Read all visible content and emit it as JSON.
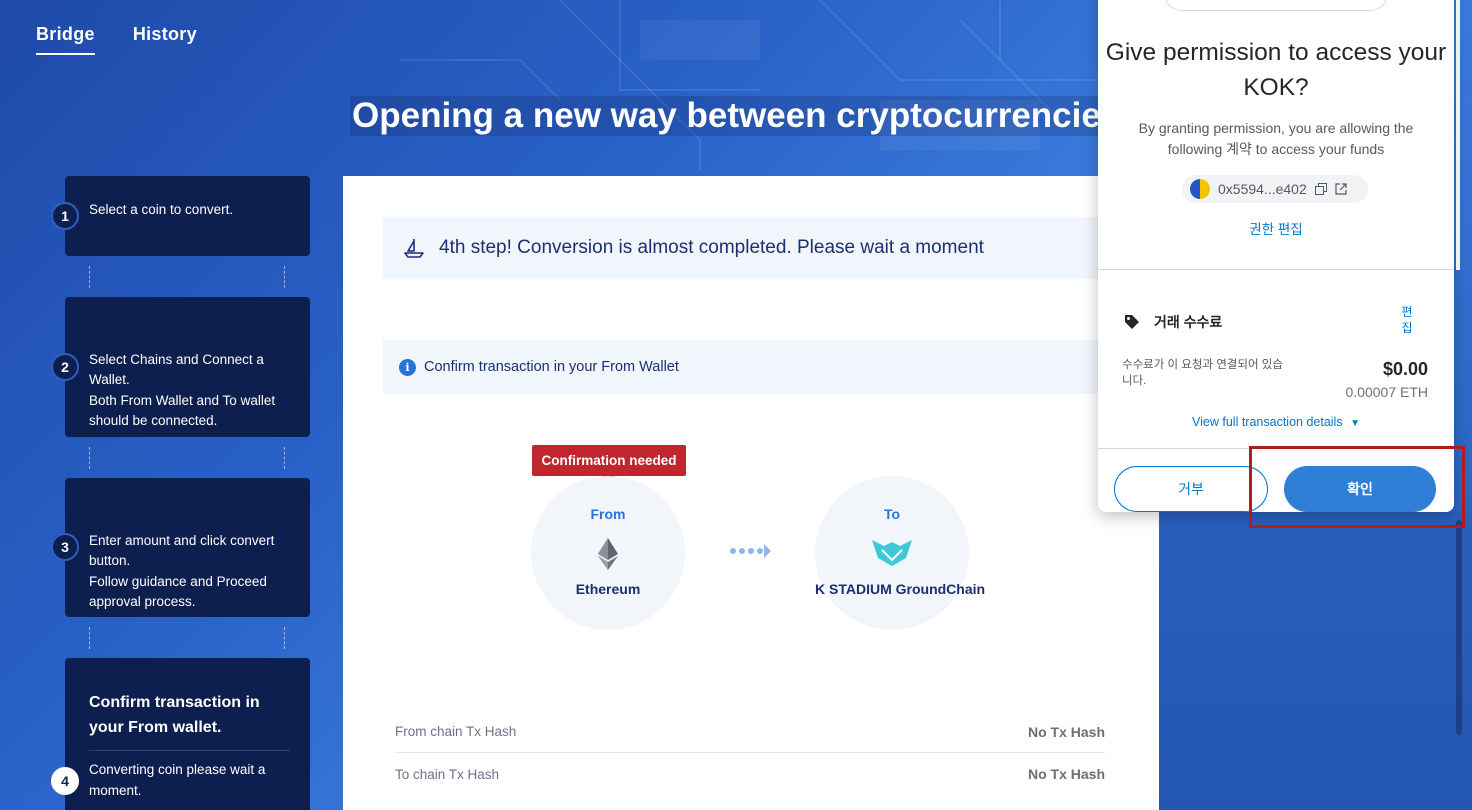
{
  "nav": {
    "tabs": [
      {
        "label": "Bridge",
        "active": true
      },
      {
        "label": "History",
        "active": false
      }
    ]
  },
  "hero": {
    "title": "Opening a new way between cryptocurrencies."
  },
  "steps": [
    {
      "number": "1",
      "text": "Select a coin to convert."
    },
    {
      "number": "2",
      "text": "Select Chains and Connect a Wallet.\nBoth From Wallet and To wallet should be connected."
    },
    {
      "number": "3",
      "text": "Enter amount and click convert button.\nFollow guidance and Proceed approval process."
    },
    {
      "number": "4",
      "title": "Confirm transaction in your From wallet.",
      "text": "Converting coin please wait a moment."
    }
  ],
  "main": {
    "notice": "4th step! Conversion is almost completed. Please wait a moment",
    "info": "Confirm transaction in your From Wallet",
    "info_icon": "i",
    "confirm_tag": "Confirmation needed",
    "from": {
      "label": "From",
      "chain": "Ethereum"
    },
    "to": {
      "label": "To",
      "chain": "K STADIUM GroundChain"
    },
    "hashes": [
      {
        "label": "From chain Tx Hash",
        "value": "No Tx Hash"
      },
      {
        "label": "To chain Tx Hash",
        "value": "No Tx Hash"
      }
    ]
  },
  "popup": {
    "title": "Give permission to access your KOK?",
    "description": "By granting permission, you are allowing the following 계약 to access your funds",
    "address": "0x5594...e402",
    "edit_permission": "권한 편집",
    "fee_title": "거래 수수료",
    "fee_edit": "편집",
    "fee_desc": "수수료가 이 요청과 연결되어 있습니다.",
    "fee_usd": "$0.00",
    "fee_eth": "0.00007 ETH",
    "details_link": "View full transaction details",
    "reject": "거부",
    "confirm": "확인"
  },
  "colors": {
    "accent": "#2f7fd6",
    "brand_navy": "#0d1f4e",
    "alert_red": "#c0262d",
    "link_blue": "#0376c9"
  }
}
